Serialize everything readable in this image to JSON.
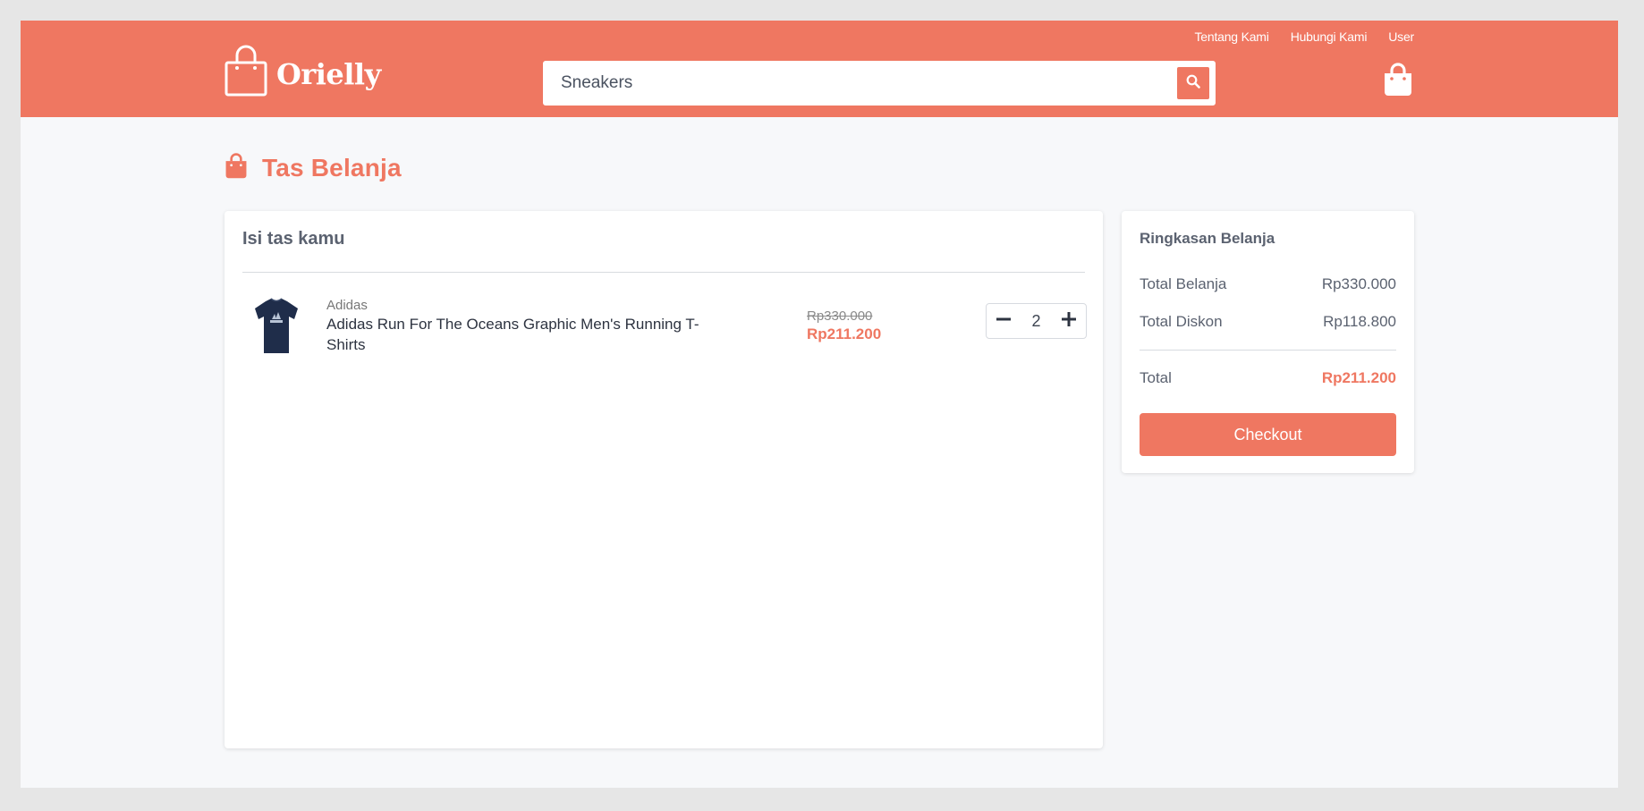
{
  "header": {
    "links": [
      "Tentang Kami",
      "Hubungi Kami",
      "User"
    ],
    "logo_text": "Orielly",
    "search_value": "Sneakers"
  },
  "page": {
    "title": "Tas Belanja"
  },
  "cart": {
    "heading": "Isi tas kamu",
    "items": [
      {
        "brand": "Adidas",
        "name": "Adidas Run For The Oceans Graphic Men's Running T-Shirts",
        "original_price": "Rp330.000",
        "price": "Rp211.200",
        "quantity": "2"
      }
    ]
  },
  "summary": {
    "heading": "Ringkasan Belanja",
    "total_belanja_label": "Total Belanja",
    "total_belanja_value": "Rp330.000",
    "total_diskon_label": "Total Diskon",
    "total_diskon_value": "Rp118.800",
    "total_label": "Total",
    "total_value": "Rp211.200",
    "checkout_label": "Checkout"
  },
  "colors": {
    "brand": "#ef7761",
    "background": "#f7f8fa"
  },
  "icons": [
    "shopping-bag-logo-icon",
    "search-icon",
    "cart-icon",
    "bag-icon",
    "minus-icon",
    "plus-icon"
  ]
}
